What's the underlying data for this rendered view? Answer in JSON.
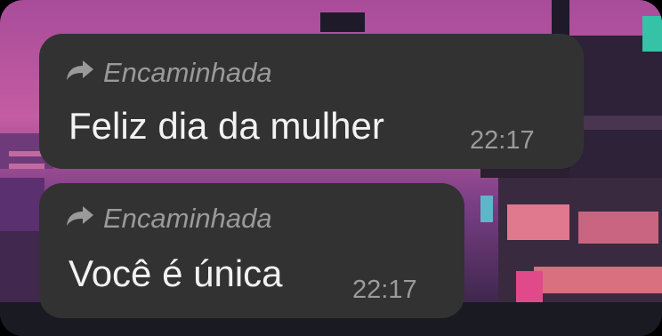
{
  "messages": [
    {
      "forward_label": "Encaminhada",
      "text": "Feliz dia da mulher",
      "time": "22:17",
      "forward_icon": "forward-arrow-icon"
    },
    {
      "forward_label": "Encaminhada",
      "text": "Você é única",
      "time": "22:17",
      "forward_icon": "forward-arrow-icon"
    }
  ],
  "colors": {
    "bubble": "#323233",
    "wallpaper_sky": "#b9509f",
    "wallpaper_accent": "#d96f8a"
  }
}
